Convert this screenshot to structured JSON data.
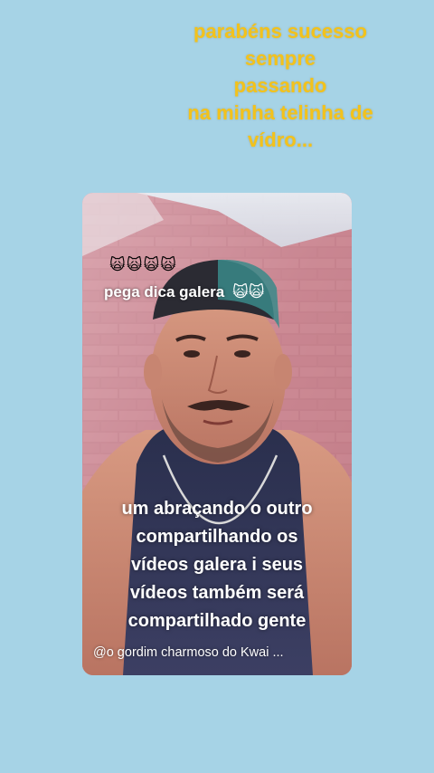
{
  "caption": {
    "lines": [
      "parabéns sucesso",
      "sempre",
      "passando",
      "na minha telinha de",
      "vídro..."
    ],
    "color": "#f3c21b"
  },
  "video": {
    "emoji_row": "🙀🙀🙀🙀",
    "title": "pega dica galera",
    "title_emoji": "🙀🙀",
    "body_lines": [
      "um abraçando o outro",
      "compartilhando os",
      "vídeos galera i seus",
      "vídeos também será",
      "compartilhado gente"
    ],
    "username": "@o gordim charmoso do Kwai ..."
  },
  "colors": {
    "background": "#a6d3e6",
    "overlay_text": "#ffffff"
  }
}
